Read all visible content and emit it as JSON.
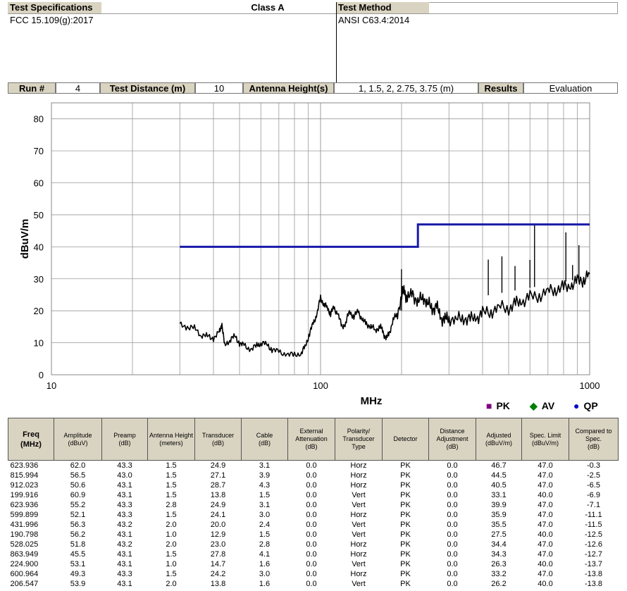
{
  "header": {
    "spec_label": "Test Specifications",
    "class_label": "Class A",
    "method_label": "Test Method",
    "spec_value": "FCC 15.109(g):2017",
    "method_value": "ANSI C63.4:2014"
  },
  "runbar": {
    "run_label": "Run #",
    "run_value": "4",
    "distance_label": "Test Distance (m)",
    "distance_value": "10",
    "antenna_label": "Antenna Height(s)",
    "antenna_value": "1,  1.5,  2,  2.75,  3.75 (m)",
    "results_label": "Results",
    "results_value": "Evaluation"
  },
  "legend": [
    {
      "symbol": "■",
      "label": "PK",
      "color": "#800080"
    },
    {
      "symbol": "◆",
      "label": "AV",
      "color": "#008000"
    },
    {
      "symbol": "●",
      "label": "QP",
      "color": "#0000cc"
    }
  ],
  "chart_data": {
    "type": "line",
    "title": "",
    "xlabel": "MHz",
    "ylabel": "dBuV/m",
    "x_scale": "log",
    "xlim": [
      10,
      1000
    ],
    "ylim": [
      0,
      85
    ],
    "x_tick_labels": [
      "10",
      "100",
      "1000"
    ],
    "y_ticks": [
      0,
      10,
      20,
      30,
      40,
      50,
      60,
      70,
      80
    ],
    "grid": true,
    "limit_color": "#1a1aaa",
    "trace_color": "#000000",
    "series": [
      {
        "kind": "limit",
        "points": [
          [
            30,
            40
          ],
          [
            230,
            40
          ],
          [
            230,
            47
          ],
          [
            1000,
            47
          ]
        ]
      },
      {
        "kind": "trace",
        "points": [
          [
            30,
            15.5
          ],
          [
            32,
            15
          ],
          [
            34,
            14.5
          ],
          [
            36,
            12.5
          ],
          [
            38,
            12
          ],
          [
            40,
            11.5
          ],
          [
            42,
            13
          ],
          [
            43,
            16
          ],
          [
            44,
            9
          ],
          [
            46,
            11
          ],
          [
            48,
            12
          ],
          [
            50,
            10
          ],
          [
            52,
            9
          ],
          [
            55,
            8
          ],
          [
            58,
            9
          ],
          [
            60,
            10
          ],
          [
            63,
            9.5
          ],
          [
            66,
            8
          ],
          [
            70,
            7
          ],
          [
            75,
            6.5
          ],
          [
            80,
            6
          ],
          [
            85,
            7
          ],
          [
            88,
            9
          ],
          [
            91,
            13
          ],
          [
            94,
            16
          ],
          [
            97,
            19
          ],
          [
            100,
            24
          ],
          [
            103,
            22
          ],
          [
            106,
            21
          ],
          [
            109,
            19
          ],
          [
            112,
            21
          ],
          [
            116,
            19
          ],
          [
            120,
            15
          ],
          [
            124,
            16
          ],
          [
            128,
            20
          ],
          [
            133,
            18
          ],
          [
            138,
            20
          ],
          [
            143,
            17
          ],
          [
            148,
            16
          ],
          [
            154,
            15
          ],
          [
            160,
            14
          ],
          [
            166,
            15
          ],
          [
            170,
            14
          ],
          [
            175,
            11
          ],
          [
            180,
            13
          ],
          [
            186,
            17
          ],
          [
            192,
            19
          ],
          [
            200,
            24
          ],
          [
            205,
            27
          ],
          [
            210,
            23
          ],
          [
            220,
            26
          ],
          [
            230,
            22
          ],
          [
            240,
            25
          ],
          [
            250,
            22
          ],
          [
            260,
            21
          ],
          [
            270,
            21
          ],
          [
            280,
            18
          ],
          [
            290,
            17
          ],
          [
            300,
            18
          ],
          [
            320,
            17
          ],
          [
            340,
            18
          ],
          [
            360,
            17
          ],
          [
            380,
            18
          ],
          [
            400,
            19
          ],
          [
            430,
            20
          ],
          [
            460,
            21
          ],
          [
            500,
            21
          ],
          [
            530,
            22
          ],
          [
            560,
            23
          ],
          [
            600,
            24
          ],
          [
            650,
            25
          ],
          [
            700,
            26
          ],
          [
            750,
            27
          ],
          [
            800,
            27
          ],
          [
            850,
            28
          ],
          [
            900,
            29
          ],
          [
            950,
            30
          ],
          [
            1000,
            31.5
          ]
        ]
      },
      {
        "kind": "spikes",
        "points": [
          [
            199.9,
            33
          ],
          [
            420,
            36
          ],
          [
            472,
            37
          ],
          [
            528,
            34
          ],
          [
            600,
            35.9
          ],
          [
            623.9,
            46.7
          ],
          [
            815.9,
            44.5
          ],
          [
            863.9,
            34.3
          ],
          [
            912,
            40.5
          ]
        ]
      }
    ]
  },
  "table": {
    "headers": [
      "Freq\n(MHz)",
      "Amplitude\n(dBuV)",
      "Preamp\n(dB)",
      "Antenna Height\n(meters)",
      "Transducer\n(dB)",
      "Cable\n(dB)",
      "External\nAttenuation\n(dB)",
      "Polarity/\nTransducer\nType",
      "Detector",
      "Distance\nAdjustment\n(dB)",
      "Adjusted\n(dBuV/m)",
      "Spec. Limit\n(dBuV/m)",
      "Compared to\nSpec.\n(dB)"
    ],
    "rows": [
      [
        "623.936",
        "62.0",
        "43.3",
        "1.5",
        "24.9",
        "3.1",
        "0.0",
        "Horz",
        "PK",
        "0.0",
        "46.7",
        "47.0",
        "-0.3"
      ],
      [
        "815.994",
        "56.5",
        "43.0",
        "1.5",
        "27.1",
        "3.9",
        "0.0",
        "Horz",
        "PK",
        "0.0",
        "44.5",
        "47.0",
        "-2.5"
      ],
      [
        "912.023",
        "50.6",
        "43.1",
        "1.5",
        "28.7",
        "4.3",
        "0.0",
        "Horz",
        "PK",
        "0.0",
        "40.5",
        "47.0",
        "-6.5"
      ],
      [
        "199.916",
        "60.9",
        "43.1",
        "1.5",
        "13.8",
        "1.5",
        "0.0",
        "Vert",
        "PK",
        "0.0",
        "33.1",
        "40.0",
        "-6.9"
      ],
      [
        "623.936",
        "55.2",
        "43.3",
        "2.8",
        "24.9",
        "3.1",
        "0.0",
        "Vert",
        "PK",
        "0.0",
        "39.9",
        "47.0",
        "-7.1"
      ],
      [
        "599.899",
        "52.1",
        "43.3",
        "1.5",
        "24.1",
        "3.0",
        "0.0",
        "Horz",
        "PK",
        "0.0",
        "35.9",
        "47.0",
        "-11.1"
      ],
      [
        "431.996",
        "56.3",
        "43.2",
        "2.0",
        "20.0",
        "2.4",
        "0.0",
        "Vert",
        "PK",
        "0.0",
        "35.5",
        "47.0",
        "-11.5"
      ],
      [
        "190.798",
        "56.2",
        "43.1",
        "1.0",
        "12.9",
        "1.5",
        "0.0",
        "Vert",
        "PK",
        "0.0",
        "27.5",
        "40.0",
        "-12.5"
      ],
      [
        "528.025",
        "51.8",
        "43.2",
        "2.0",
        "23.0",
        "2.8",
        "0.0",
        "Horz",
        "PK",
        "0.0",
        "34.4",
        "47.0",
        "-12.6"
      ],
      [
        "863.949",
        "45.5",
        "43.1",
        "1.5",
        "27.8",
        "4.1",
        "0.0",
        "Horz",
        "PK",
        "0.0",
        "34.3",
        "47.0",
        "-12.7"
      ],
      [
        "224.900",
        "53.1",
        "43.1",
        "1.0",
        "14.7",
        "1.6",
        "0.0",
        "Vert",
        "PK",
        "0.0",
        "26.3",
        "40.0",
        "-13.7"
      ],
      [
        "600.964",
        "49.3",
        "43.3",
        "1.5",
        "24.2",
        "3.0",
        "0.0",
        "Horz",
        "PK",
        "0.0",
        "33.2",
        "47.0",
        "-13.8"
      ],
      [
        "206.547",
        "53.9",
        "43.1",
        "2.0",
        "13.8",
        "1.6",
        "0.0",
        "Vert",
        "PK",
        "0.0",
        "26.2",
        "40.0",
        "-13.8"
      ]
    ]
  }
}
